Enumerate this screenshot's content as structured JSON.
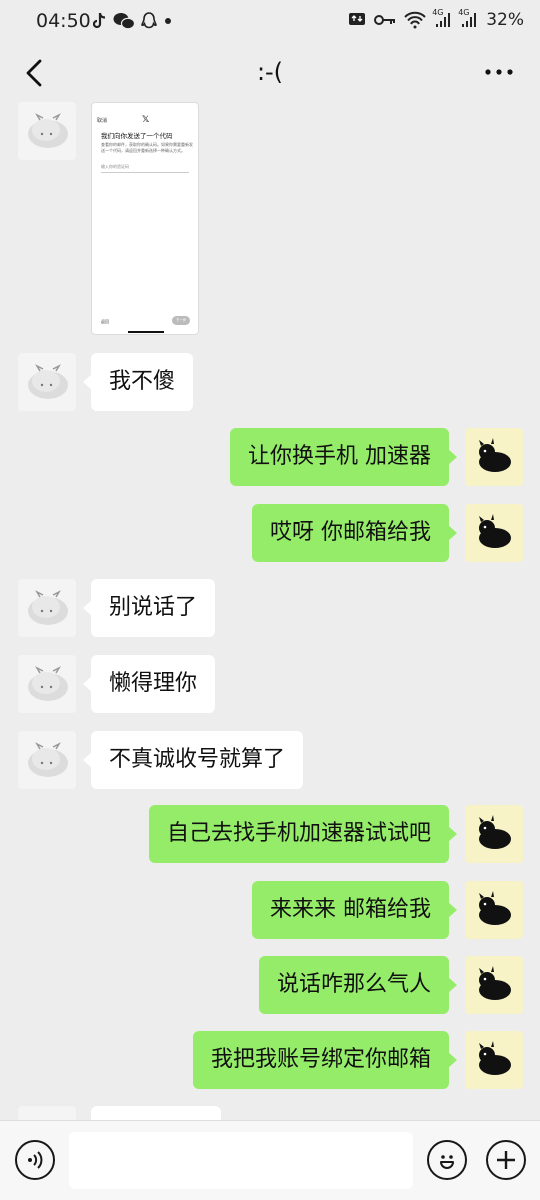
{
  "status_bar": {
    "time": "04:50",
    "battery": "32%",
    "network_1": "4G",
    "network_2": "4G"
  },
  "header": {
    "title": ":-(",
    "back_icon": "chevron-left-icon",
    "more_icon": "more-horizontal-icon"
  },
  "image_message": {
    "cancel": "取消",
    "heading": "我们向你发送了一个代码",
    "description": "查看你的邮件，获取你的确认码。如果你需要重新发送一个代码，请返回并重新选择一种确认方式。",
    "field_placeholder": "输入你的验证码",
    "back": "返回",
    "next": "下一步"
  },
  "messages": [
    {
      "side": "left",
      "text": "我不傻"
    },
    {
      "side": "right",
      "text": "让你换手机  加速器"
    },
    {
      "side": "right",
      "text": "哎呀  你邮箱给我"
    },
    {
      "side": "left",
      "text": "别说话了"
    },
    {
      "side": "left",
      "text": "懒得理你"
    },
    {
      "side": "left",
      "text": "不真诚收号就算了"
    },
    {
      "side": "right",
      "text": "自己去找手机加速器试试吧"
    },
    {
      "side": "right",
      "text": "来来来  邮箱给我"
    },
    {
      "side": "right",
      "text": "说话咋那么气人"
    },
    {
      "side": "right",
      "text": "我把我账号绑定你邮箱"
    }
  ],
  "input_bar": {
    "placeholder": "",
    "voice_icon": "voice-icon",
    "emoji_icon": "emoji-icon",
    "plus_icon": "plus-icon"
  },
  "colors": {
    "background": "#ededed",
    "my_bubble": "#95ec69",
    "friend_bubble": "#ffffff"
  }
}
